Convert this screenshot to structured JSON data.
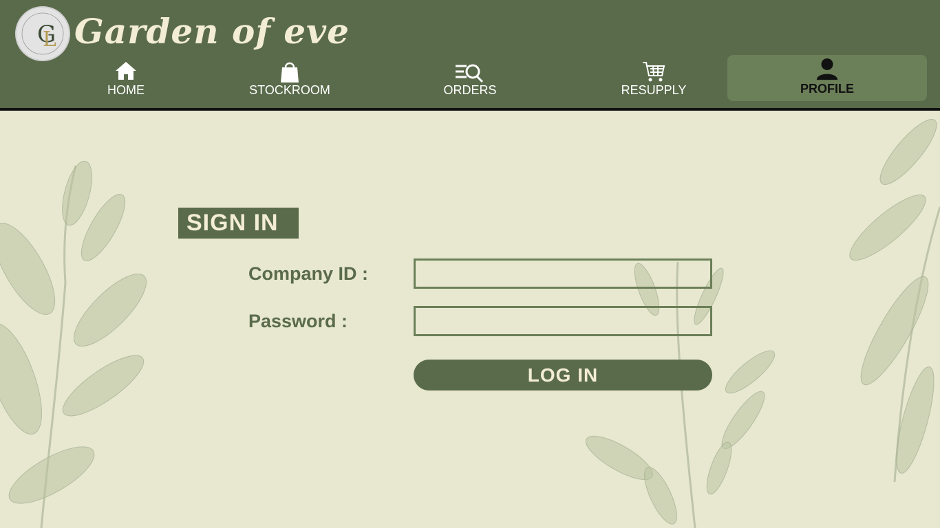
{
  "brand": {
    "name": "Garden of eve",
    "logo_monogram": "GL",
    "logo_ring_text": "GARDEN OF EVE",
    "colors": {
      "primary": "#5a6b4b",
      "active_tab": "#6b7f58",
      "background": "#e8e8d0",
      "accent": "#f3edd6"
    }
  },
  "nav": {
    "items": [
      {
        "label": "HOME",
        "icon": "home-icon"
      },
      {
        "label": "STOCKROOM",
        "icon": "shopping-bag-icon"
      },
      {
        "label": "ORDERS",
        "icon": "search-list-icon"
      },
      {
        "label": "RESUPPLY",
        "icon": "cart-icon"
      },
      {
        "label": "PROFILE",
        "icon": "user-icon",
        "active": true
      }
    ]
  },
  "signin": {
    "title": "SIGN IN",
    "company_id_label": "Company ID :",
    "company_id_value": "",
    "password_label": "Password :",
    "password_value": "",
    "login_label": "LOG IN"
  }
}
